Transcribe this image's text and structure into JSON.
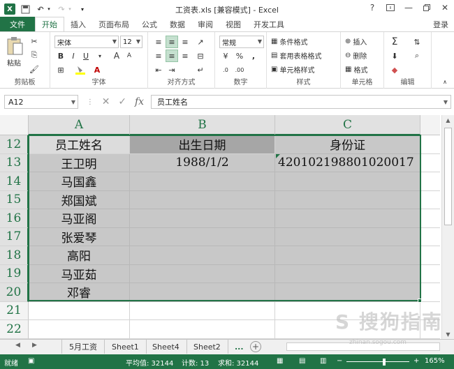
{
  "title": {
    "text": "工资表.xls [兼容模式] - Excel",
    "help": "?",
    "win_icons": [
      "ribbon-display-icon",
      "minimize-icon",
      "restore-icon",
      "close-icon"
    ]
  },
  "tabs": {
    "file": "文件",
    "items": [
      "开始",
      "插入",
      "页面布局",
      "公式",
      "数据",
      "审阅",
      "视图",
      "开发工具"
    ],
    "active": "开始",
    "login": "登录"
  },
  "ribbon": {
    "clipboard": {
      "label": "剪贴板",
      "paste": "粘贴"
    },
    "font": {
      "label": "字体",
      "name": "宋体",
      "size": "12",
      "bold": "B",
      "italic": "I",
      "underline": "U"
    },
    "align": {
      "label": "对齐方式"
    },
    "number": {
      "label": "数字",
      "format": "常规"
    },
    "styles": {
      "label": "样式",
      "cond": "条件格式",
      "table": "套用表格格式",
      "cell": "单元格样式"
    },
    "cells": {
      "label": "单元格",
      "insert": "插入",
      "delete": "删除",
      "format": "格式"
    },
    "editing": {
      "label": "编辑"
    }
  },
  "formula_bar": {
    "name_box": "A12",
    "fx": "fx",
    "value": "员工姓名"
  },
  "grid": {
    "columns": [
      "A",
      "B",
      "C"
    ],
    "rows": [
      "12",
      "13",
      "14",
      "15",
      "16",
      "17",
      "18",
      "19",
      "20",
      "21",
      "22"
    ],
    "cells": {
      "A12": "员工姓名",
      "B12": "出生日期",
      "C12": "身份证",
      "A13": "王卫明",
      "B13": "1988/1/2",
      "C13": "420102198801020017",
      "A14": "马国鑫",
      "A15": "郑国斌",
      "A16": "马亚阁",
      "A17": "张爱琴",
      "A18": "高阳",
      "A19": "马亚茹",
      "A20": "邓睿"
    }
  },
  "sheets": {
    "tabs": [
      "5月工资",
      "Sheet1",
      "Sheet4",
      "Sheet2"
    ],
    "more": "...",
    "add": "+"
  },
  "status": {
    "ready": "就绪",
    "average": "平均值: 32144",
    "count": "计数: 13",
    "sum": "求和: 32144",
    "zoom": "165%",
    "zoom_minus": "−",
    "zoom_plus": "+"
  },
  "colors": {
    "accent": "#217346",
    "selection_fill": "#c8c8c8"
  }
}
